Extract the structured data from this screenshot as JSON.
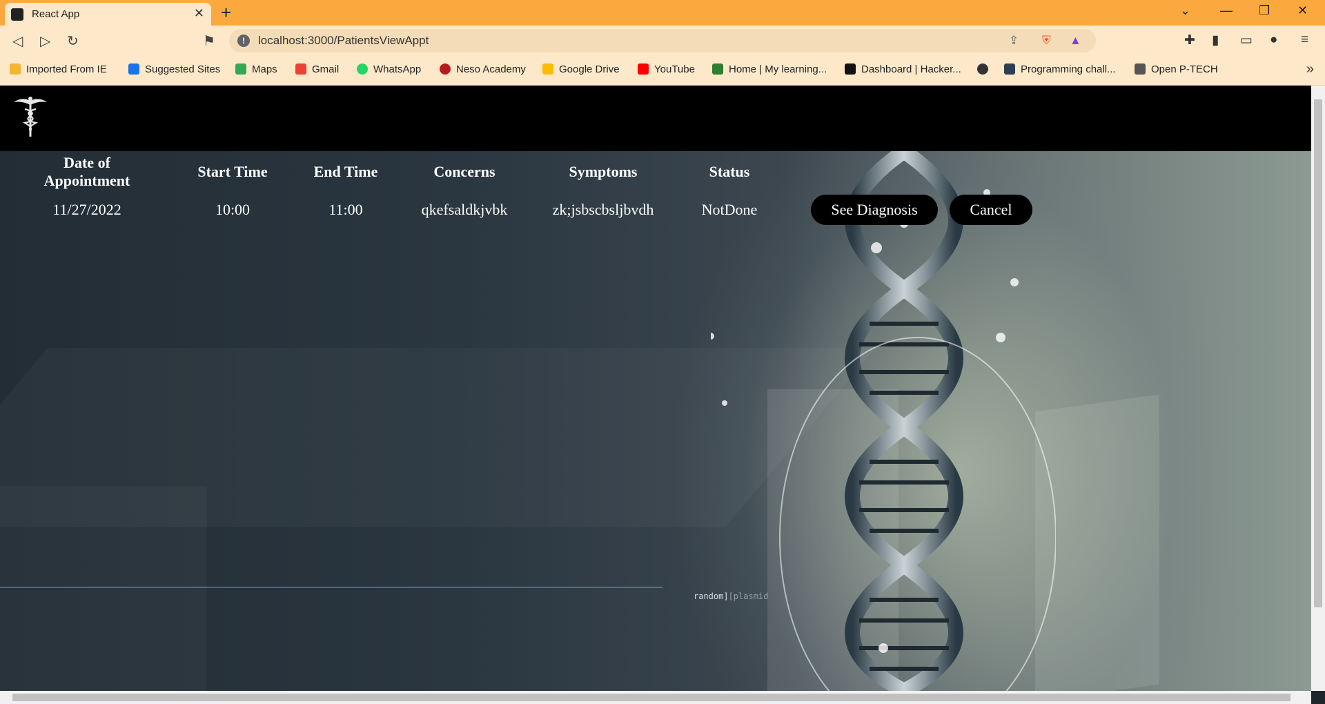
{
  "browser": {
    "tab_title": "React App",
    "url": "localhost:3000/PatientsViewAppt",
    "bookmarks": [
      {
        "label": "Imported From IE",
        "icon": "folder-icon",
        "color": "#f2b631"
      },
      {
        "label": "Suggested Sites",
        "icon": "bing-icon",
        "color": "#1a73e8"
      },
      {
        "label": "Maps",
        "icon": "maps-icon",
        "color": "#34a853"
      },
      {
        "label": "Gmail",
        "icon": "gmail-icon",
        "color": "#ea4335"
      },
      {
        "label": "WhatsApp",
        "icon": "whatsapp-icon",
        "color": "#25d366"
      },
      {
        "label": "Neso Academy",
        "icon": "neso-icon",
        "color": "#b71c1c"
      },
      {
        "label": "Google Drive",
        "icon": "drive-icon",
        "color": "#fbbc04"
      },
      {
        "label": "YouTube",
        "icon": "youtube-icon",
        "color": "#ff0000"
      },
      {
        "label": "Home | My learning...",
        "icon": "w3-icon",
        "color": "#2e7d32"
      },
      {
        "label": "Dashboard | Hacker...",
        "icon": "hackerrank-icon",
        "color": "#111111"
      },
      {
        "label": "",
        "icon": "globe-icon",
        "color": "#333333"
      },
      {
        "label": "Programming chall...",
        "icon": "hackerearth-icon",
        "color": "#2c3e50"
      },
      {
        "label": "Open P-TECH",
        "icon": "ptech-icon",
        "color": "#555555"
      }
    ]
  },
  "appointments": {
    "headers": [
      "Date of Appointment",
      "Start Time",
      "End Time",
      "Concerns",
      "Symptoms",
      "Status"
    ],
    "rows": [
      {
        "date": "11/27/2022",
        "start": "10:00",
        "end": "11:00",
        "concerns": "qkefsaldkjvbk",
        "symptoms": "zk;jsbscbsljbvdh",
        "status": "NotDone",
        "diagnosis_button": "See Diagnosis",
        "cancel_button": "Cancel"
      }
    ]
  },
  "background": {
    "caption_main": "random]",
    "caption_dim": "[plasmid"
  },
  "colors": {
    "chrome": "#fba93f",
    "chrome_light": "#fde9c9",
    "navbar": "#000000",
    "button_bg": "#000000"
  }
}
